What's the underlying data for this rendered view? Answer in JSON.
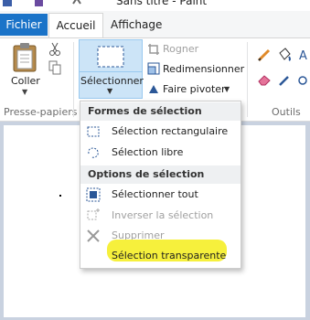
{
  "window": {
    "title": "Sans titre - Paint"
  },
  "tabs": {
    "file": "Fichier",
    "home": "Accueil",
    "view": "Affichage"
  },
  "ribbon": {
    "clipboard": {
      "paste_label": "Coller",
      "group_label": "Presse-papiers"
    },
    "image": {
      "select_label": "Sélectionner",
      "crop_label": "Rogner",
      "resize_label": "Redimensionner",
      "rotate_label": "Faire pivoter"
    },
    "tools": {
      "group_label": "Outils"
    }
  },
  "selection_menu": {
    "shapes_header": "Formes de sélection",
    "rect_label": "Sélection rectangulaire",
    "free_label": "Sélection libre",
    "options_header": "Options de sélection",
    "select_all_label": "Sélectionner tout",
    "invert_label": "Inverser la sélection",
    "delete_label": "Supprimer",
    "transparent_label": "Sélection transparente"
  },
  "colors": {
    "file_tab": "#1a73c8",
    "selected_button": "#cce4f7",
    "highlight": "#f6f03c",
    "canvas_bg": "#c9d2e0"
  }
}
